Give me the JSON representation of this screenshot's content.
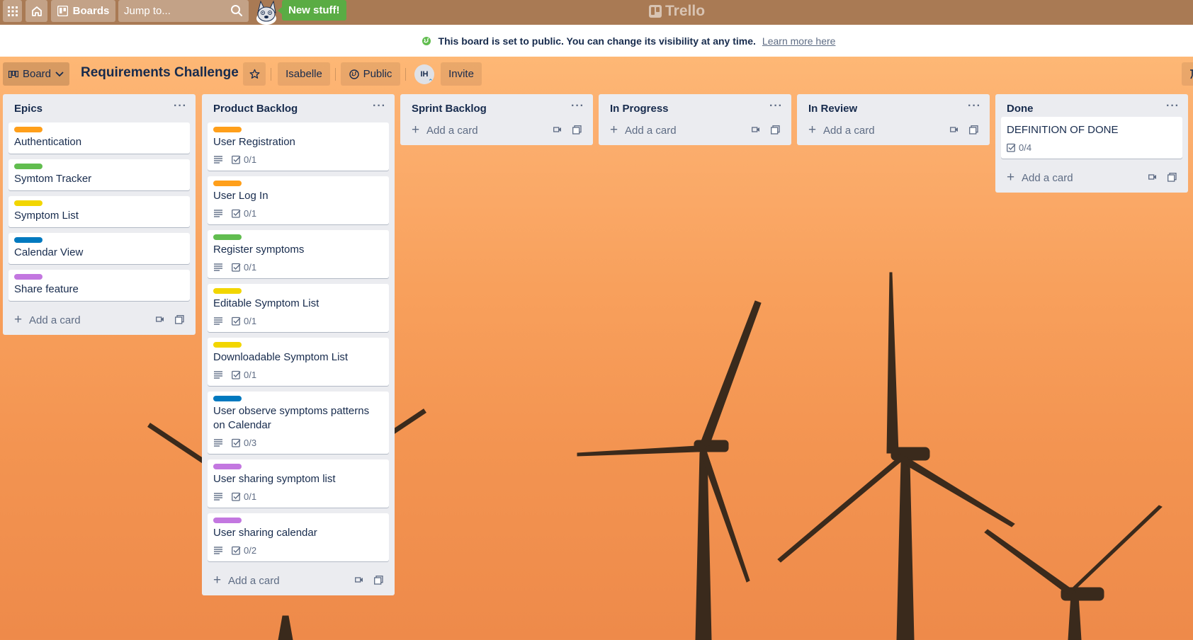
{
  "topbar": {
    "boards_label": "Boards",
    "search_placeholder": "Jump to...",
    "new_stuff_label": "New stuff!",
    "logo_text": "Trello"
  },
  "banner": {
    "text": "This board is set to public. You can change its visibility at any time.",
    "link": "Learn more here"
  },
  "board_header": {
    "view_label": "Board",
    "title": "Requirements Challenge",
    "member_label": "Isabelle",
    "visibility_label": "Public",
    "avatar_initials": "IH",
    "invite_label": "Invite"
  },
  "colors": {
    "orange": "#ff9f1a",
    "green": "#61bd4f",
    "yellow": "#f2d600",
    "blue": "#0079bf",
    "purple": "#c377e0"
  },
  "add_card_label": "Add a card",
  "lists": [
    {
      "title": "Epics",
      "cards": [
        {
          "label_color": "#ff9f1a",
          "title": "Authentication"
        },
        {
          "label_color": "#61bd4f",
          "title": "Symtom Tracker"
        },
        {
          "label_color": "#f2d600",
          "title": "Symptom List"
        },
        {
          "label_color": "#0079bf",
          "title": "Calendar View"
        },
        {
          "label_color": "#c377e0",
          "title": "Share feature"
        }
      ]
    },
    {
      "title": "Product Backlog",
      "cards": [
        {
          "label_color": "#ff9f1a",
          "title": "User Registration",
          "checklist": "0/1"
        },
        {
          "label_color": "#ff9f1a",
          "title": "User Log In",
          "checklist": "0/1"
        },
        {
          "label_color": "#61bd4f",
          "title": "Register symptoms",
          "checklist": "0/1"
        },
        {
          "label_color": "#f2d600",
          "title": "Editable Symptom List",
          "checklist": "0/1"
        },
        {
          "label_color": "#f2d600",
          "title": "Downloadable Symptom List",
          "checklist": "0/1"
        },
        {
          "label_color": "#0079bf",
          "title": "User observe symptoms patterns on Calendar",
          "checklist": "0/3"
        },
        {
          "label_color": "#c377e0",
          "title": "User sharing symptom list",
          "checklist": "0/1"
        },
        {
          "label_color": "#c377e0",
          "title": "User sharing calendar",
          "checklist": "0/2"
        }
      ]
    },
    {
      "title": "Sprint Backlog",
      "cards": []
    },
    {
      "title": "In Progress",
      "cards": []
    },
    {
      "title": "In Review",
      "cards": []
    },
    {
      "title": "Done",
      "cards": [
        {
          "title": "DEFINITION OF DONE",
          "checklist": "0/4"
        }
      ]
    }
  ]
}
